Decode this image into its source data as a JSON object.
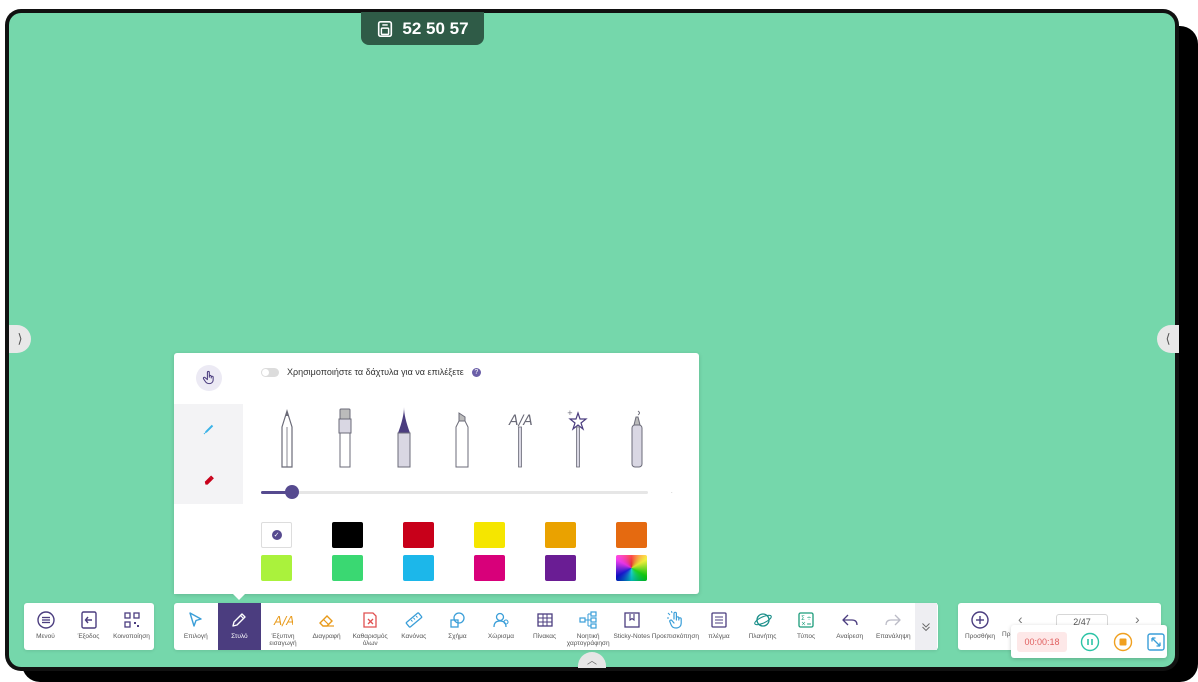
{
  "session_code": "52 50 57",
  "pen_panel": {
    "finger_select_label": "Χρησιμοποιήστε τα δάχτυλα για να επιλέξετε",
    "finger_select_enabled": false,
    "pen_types": [
      "pencil",
      "marker",
      "brush",
      "highlighter",
      "text-pen",
      "magic-pen",
      "laser-pen"
    ],
    "selected_pen_type": "brush",
    "thickness": 0.08,
    "colors": [
      "#ffffff",
      "#000000",
      "#c8001a",
      "#f5e600",
      "#eaa200",
      "#e56a10",
      "#aaf23c",
      "#3ad872",
      "#1cb7ea",
      "#d8007a",
      "#6a1d94",
      "rainbow"
    ],
    "selected_color_index": 0,
    "accent": "#564a8f"
  },
  "left_toolbar": {
    "items": [
      {
        "label": "Μενού",
        "icon": "menu-icon"
      },
      {
        "label": "Έξοδος",
        "icon": "exit-icon"
      },
      {
        "label": "Κοινοποίηση",
        "icon": "qr-code-icon"
      }
    ]
  },
  "main_toolbar": {
    "items": [
      {
        "label": "Επιλογή",
        "icon": "cursor-icon"
      },
      {
        "label": "Στυλό",
        "icon": "pen-icon",
        "active": true
      },
      {
        "label": "Έξυπνη εισαγωγή",
        "icon": "smart-ink-icon"
      },
      {
        "label": "Διαγραφή",
        "icon": "eraser-icon"
      },
      {
        "label": "Καθαρισμός όλων",
        "icon": "clear-all-icon"
      },
      {
        "label": "Κανόνας",
        "icon": "ruler-icon"
      },
      {
        "label": "Σχήμα",
        "icon": "shape-icon"
      },
      {
        "label": "Χώρισμα",
        "icon": "split-icon"
      },
      {
        "label": "Πίνακας",
        "icon": "table-icon"
      },
      {
        "label": "Νοητική χαρτογράφηση",
        "icon": "mind-map-icon"
      },
      {
        "label": "Sticky-Notes",
        "icon": "sticky-note-icon"
      },
      {
        "label": "Προεπισκόπηση",
        "icon": "preview-icon"
      },
      {
        "label": "πλέγμα",
        "icon": "grid-icon"
      },
      {
        "label": "Πλανήτης",
        "icon": "planet-icon"
      },
      {
        "label": "Τύπος",
        "icon": "formula-icon"
      },
      {
        "label": "Αναίρεση",
        "icon": "undo-icon"
      },
      {
        "label": "Επανάληψη",
        "icon": "redo-icon"
      }
    ]
  },
  "right_toolbar": {
    "add_label": "Προσθήκη",
    "cut_label": "Πρ",
    "page_indicator": "2/47"
  },
  "recorder": {
    "elapsed": "00:00:18",
    "accent": "#2cc3a6"
  }
}
